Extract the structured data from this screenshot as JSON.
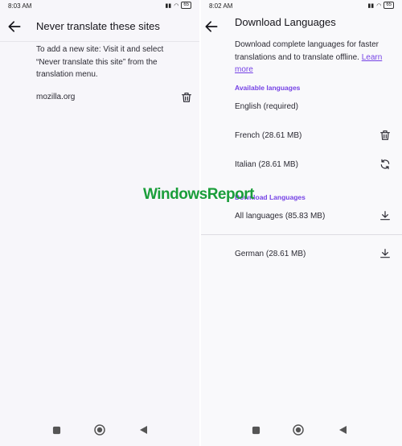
{
  "left": {
    "status_time": "8:03 AM",
    "battery": "65",
    "title": "Never translate these sites",
    "description": "To add a new site: Visit it and select “Never translate this site” from the translation menu.",
    "sites": [
      {
        "name": "mozilla.org"
      }
    ]
  },
  "right": {
    "status_time": "8:02 AM",
    "battery": "65",
    "title": "Download Languages",
    "description": "Download complete languages for faster translations and to translate offline.",
    "learn_more": "Learn more",
    "available_header": "Available languages",
    "available": [
      {
        "label": "English (required)",
        "action": "none"
      },
      {
        "label": "French (28.61 MB)",
        "action": "delete"
      },
      {
        "label": "Italian (28.61 MB)",
        "action": "sync"
      }
    ],
    "download_header": "Download Languages",
    "all_languages": "All languages (85.83 MB)",
    "to_download": [
      {
        "label": "German (28.61 MB)"
      }
    ]
  },
  "watermark": {
    "text": "WindowsReport"
  },
  "colors": {
    "accent": "#7542e5",
    "watermark": "#1a9e3a"
  }
}
